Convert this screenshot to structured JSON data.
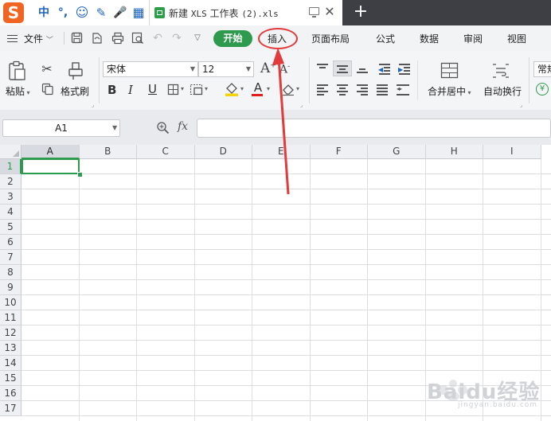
{
  "ime": {
    "logo": "S",
    "items": [
      "中",
      "°,",
      "☺",
      "✎",
      "🎤",
      "▦"
    ]
  },
  "title_tab": {
    "prefix": "新建 ",
    "mono_name": "XLS",
    "suffix": " 工作表 ",
    "mono_ext": "(2).xls",
    "close": "✕"
  },
  "new_tab": "+",
  "menu": {
    "file": "文件",
    "tabs": [
      "开始",
      "插入",
      "页面布局",
      "公式",
      "数据",
      "审阅",
      "视图"
    ]
  },
  "ribbon": {
    "paste": "粘贴",
    "format_painter": "格式刷",
    "font_name": "宋体",
    "font_size": "12",
    "merge_center": "合并居中",
    "wrap_text": "自动换行",
    "normal": "常规",
    "bold": "B",
    "italic": "I",
    "underline": "U",
    "font_color_letter": "A",
    "grow_font": "A",
    "shrink_font": "A"
  },
  "formula_bar": {
    "name_box": "A1",
    "fx": "fx",
    "value": ""
  },
  "grid": {
    "columns": [
      "A",
      "B",
      "C",
      "D",
      "E",
      "F",
      "G",
      "H",
      "I"
    ],
    "rows": [
      "1",
      "2",
      "3",
      "4",
      "5",
      "6",
      "7",
      "8",
      "9",
      "10",
      "11",
      "12",
      "13",
      "14",
      "15",
      "16",
      "17"
    ],
    "selected_cell": "A1"
  },
  "watermark": {
    "text": "Baidu经验",
    "sub": "jingyan.baidu.com"
  },
  "colors": {
    "accent_green": "#2e9a4d",
    "annotation_red": "#e23b3b"
  }
}
